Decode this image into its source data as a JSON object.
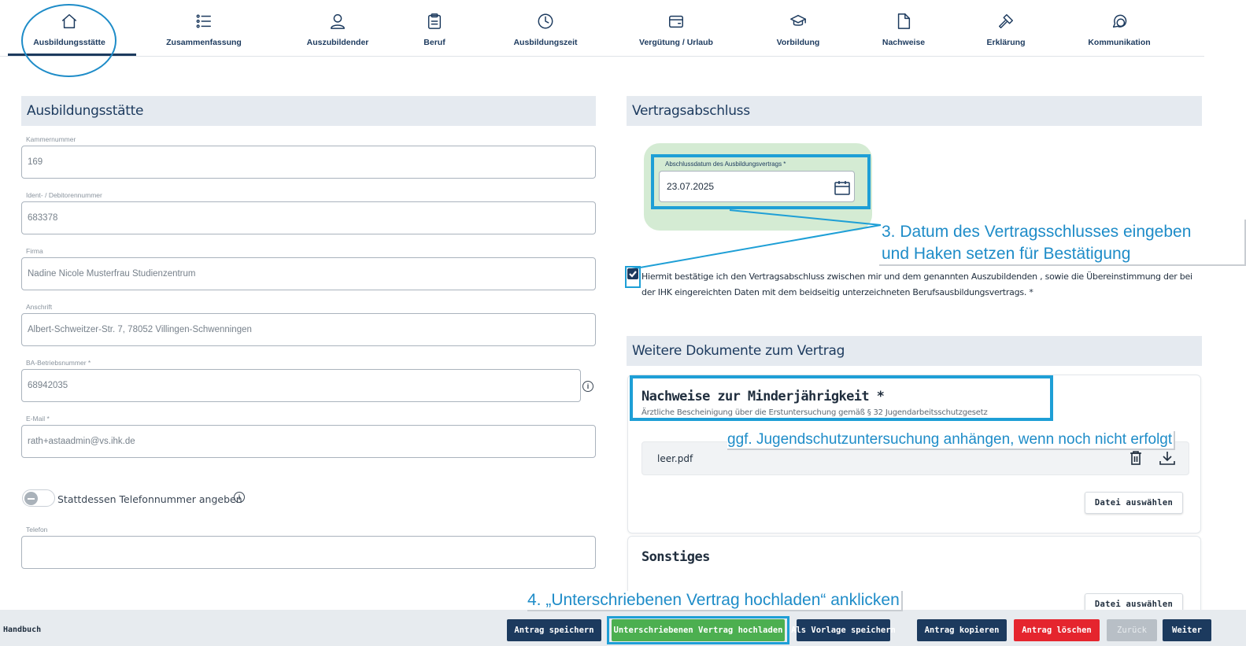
{
  "nav": {
    "items": [
      {
        "label": "Ausbildungsstätte",
        "icon": "home-icon"
      },
      {
        "label": "Zusammenfassung",
        "icon": "list-icon"
      },
      {
        "label": "Auszubildender",
        "icon": "user-icon"
      },
      {
        "label": "Beruf",
        "icon": "clipboard-icon"
      },
      {
        "label": "Ausbildungszeit",
        "icon": "clock-icon"
      },
      {
        "label": "Vergütung / Urlaub",
        "icon": "wallet-icon"
      },
      {
        "label": "Vorbildung",
        "icon": "graduation-cap-icon"
      },
      {
        "label": "Nachweise",
        "icon": "document-icon"
      },
      {
        "label": "Erklärung",
        "icon": "gavel-icon"
      },
      {
        "label": "Kommunikation",
        "icon": "chat-icon"
      }
    ],
    "active": "Ausbildungsstätte"
  },
  "left": {
    "section_title": "Ausbildungsstätte",
    "fields": [
      {
        "label": "Kammernummer",
        "value": "169"
      },
      {
        "label": "Ident- / Debitorennummer",
        "value": "683378"
      },
      {
        "label": "Firma",
        "value": "Nadine Nicole Musterfrau Studienzentrum"
      },
      {
        "label": "Anschrift",
        "value": "Albert-Schweitzer-Str. 7, 78052 Villingen-Schwenningen"
      },
      {
        "label": "BA-Betriebsnummer *",
        "value": "68942035"
      },
      {
        "label": "E-Mail *",
        "value": "rath+astaadmin@vs.ihk.de"
      }
    ],
    "toggle_label": "Stattdessen Telefonnummer angeben",
    "phone": {
      "label": "Telefon",
      "value": ""
    }
  },
  "vertrag": {
    "section_title": "Vertragsabschluss",
    "date_label": "Abschlussdatum des Ausbildungsvertrags *",
    "date_value": "23.07.2025",
    "confirm_text": "Hiermit bestätige ich den Vertragsabschluss zwischen mir und dem genannten Auszubildenden , sowie die Übereinstimmung der bei der IHK eingereichten Daten mit dem beidseitig unterzeichneten Berufsausbildungsvertrags. *",
    "confirmed": true
  },
  "documents": {
    "section_title": "Weitere Dokumente zum Vertrag",
    "minor": {
      "title": "Nachweise zur Minderjährigkeit *",
      "subtitle": "Ärztliche Bescheinigung über die Erstuntersuchung gemäß § 32 Jugendarbeitsschutzgesetz",
      "file": "leer.pdf",
      "select_label": "Datei auswählen"
    },
    "other": {
      "title": "Sonstiges",
      "select_label": "Datei auswählen"
    }
  },
  "annotations": {
    "step3_line1": "3. Datum des Vertragsschlusses eingeben",
    "step3_line2": "und Haken setzen für Bestätigung",
    "minor_hint": "ggf. Jugendschutzuntersuchung anhängen, wenn noch nicht erfolgt",
    "step4": "4. „Unterschriebenen Vertrag hochladen“ anklicken"
  },
  "footer": {
    "handbook": "Handbuch",
    "buttons": {
      "save": "Antrag speichern",
      "upload": "Unterschriebenen Vertrag hochladen",
      "template": "Als Vorlage speichern",
      "copy": "Antrag kopieren",
      "delete": "Antrag löschen",
      "back": "Zurück",
      "next": "Weiter"
    }
  },
  "colors": {
    "navy": "#1c3a5e",
    "annotation_blue": "#1e9fd6",
    "upload_green": "#4caf50",
    "delete_red": "#e5252e",
    "disabled_gray": "#b8bfc6"
  }
}
